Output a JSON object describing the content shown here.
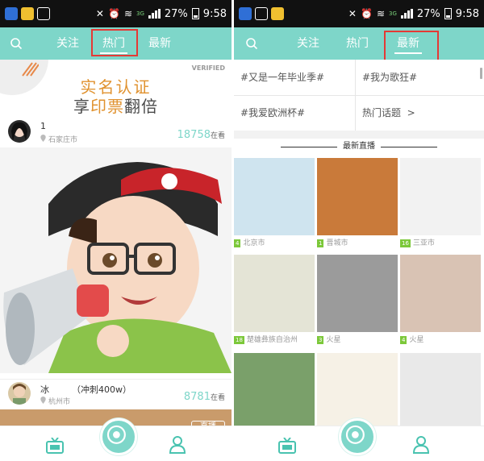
{
  "status_bar": {
    "battery": "27%",
    "time": "9:58",
    "network": "3G"
  },
  "left_screen": {
    "tabs": [
      {
        "label": "关注"
      },
      {
        "label": "热门"
      },
      {
        "label": "最新"
      }
    ],
    "active_tab": "热门",
    "banner": {
      "verified": "VERIFIED",
      "line1": "实名认证",
      "line2_pre": "享",
      "line2_hl": "印票",
      "line2_post": "翻倍"
    },
    "live_items": [
      {
        "name": "1",
        "city": "石家庄市",
        "count": "18758",
        "unit": "在看"
      },
      {
        "name": "冰        （冲刺400w）",
        "city": "杭州市",
        "count": "8781",
        "unit": "在看"
      }
    ],
    "live_badge": "直播"
  },
  "right_screen": {
    "tabs": [
      {
        "label": "关注"
      },
      {
        "label": "热门"
      },
      {
        "label": "最新"
      }
    ],
    "active_tab": "最新",
    "topics": [
      {
        "label": "#又是一年毕业季#"
      },
      {
        "label": "#我为歌狂#"
      },
      {
        "label": "#我爱欧洲杯#"
      },
      {
        "label": "热门话题  >"
      }
    ],
    "section_title": "最新直播",
    "tiles": [
      {
        "city": "北京市",
        "level": "4",
        "color": "#cfe4ef"
      },
      {
        "city": "晋城市",
        "level": "1",
        "color": "#c97a3a"
      },
      {
        "city": "三亚市",
        "level": "16",
        "color": "#f2f2f2"
      },
      {
        "city": "楚雄彝族自治州",
        "level": "18",
        "color": "#e4e4d6"
      },
      {
        "city": "火星",
        "level": "3",
        "color": "#9b9b9b"
      },
      {
        "city": "火星",
        "level": "4",
        "color": "#d9c3b4"
      },
      {
        "city": "",
        "level": "",
        "color": "#7aa06a"
      },
      {
        "city": "",
        "level": "",
        "color": "#f6f1e6"
      },
      {
        "city": "",
        "level": "",
        "color": "#e9e9e9"
      }
    ]
  }
}
